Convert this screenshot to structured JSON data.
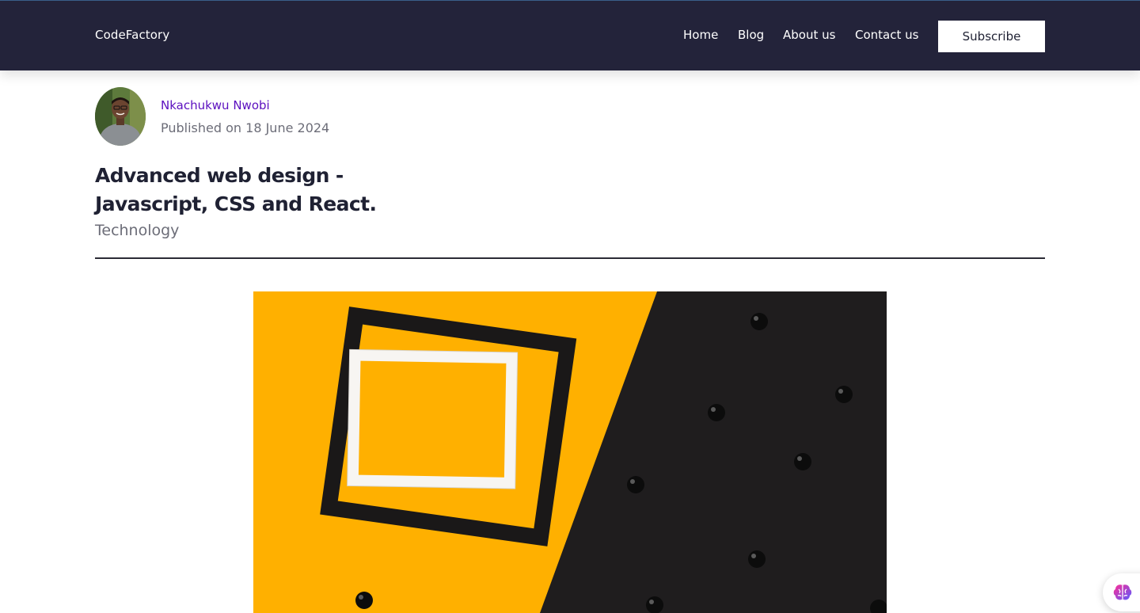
{
  "header": {
    "brand": "CodeFactory",
    "nav": [
      {
        "label": "Home"
      },
      {
        "label": "Blog"
      },
      {
        "label": "About us"
      },
      {
        "label": "Contact us"
      }
    ],
    "subscribe_label": "Subscribe"
  },
  "article": {
    "author": "Nkachukwu Nwobi",
    "published": "Published on 18 June 2024",
    "title": "Advanced web design - Javascript, CSS and React.",
    "category": "Technology"
  },
  "colors": {
    "nav_background": "#23233a",
    "author_link": "#5b0fbf",
    "muted_text": "#6c6d78",
    "hero_yellow": "#ffb000",
    "hero_black": "#1f1d1e"
  },
  "icons": {
    "assistant": "brain-icon"
  }
}
